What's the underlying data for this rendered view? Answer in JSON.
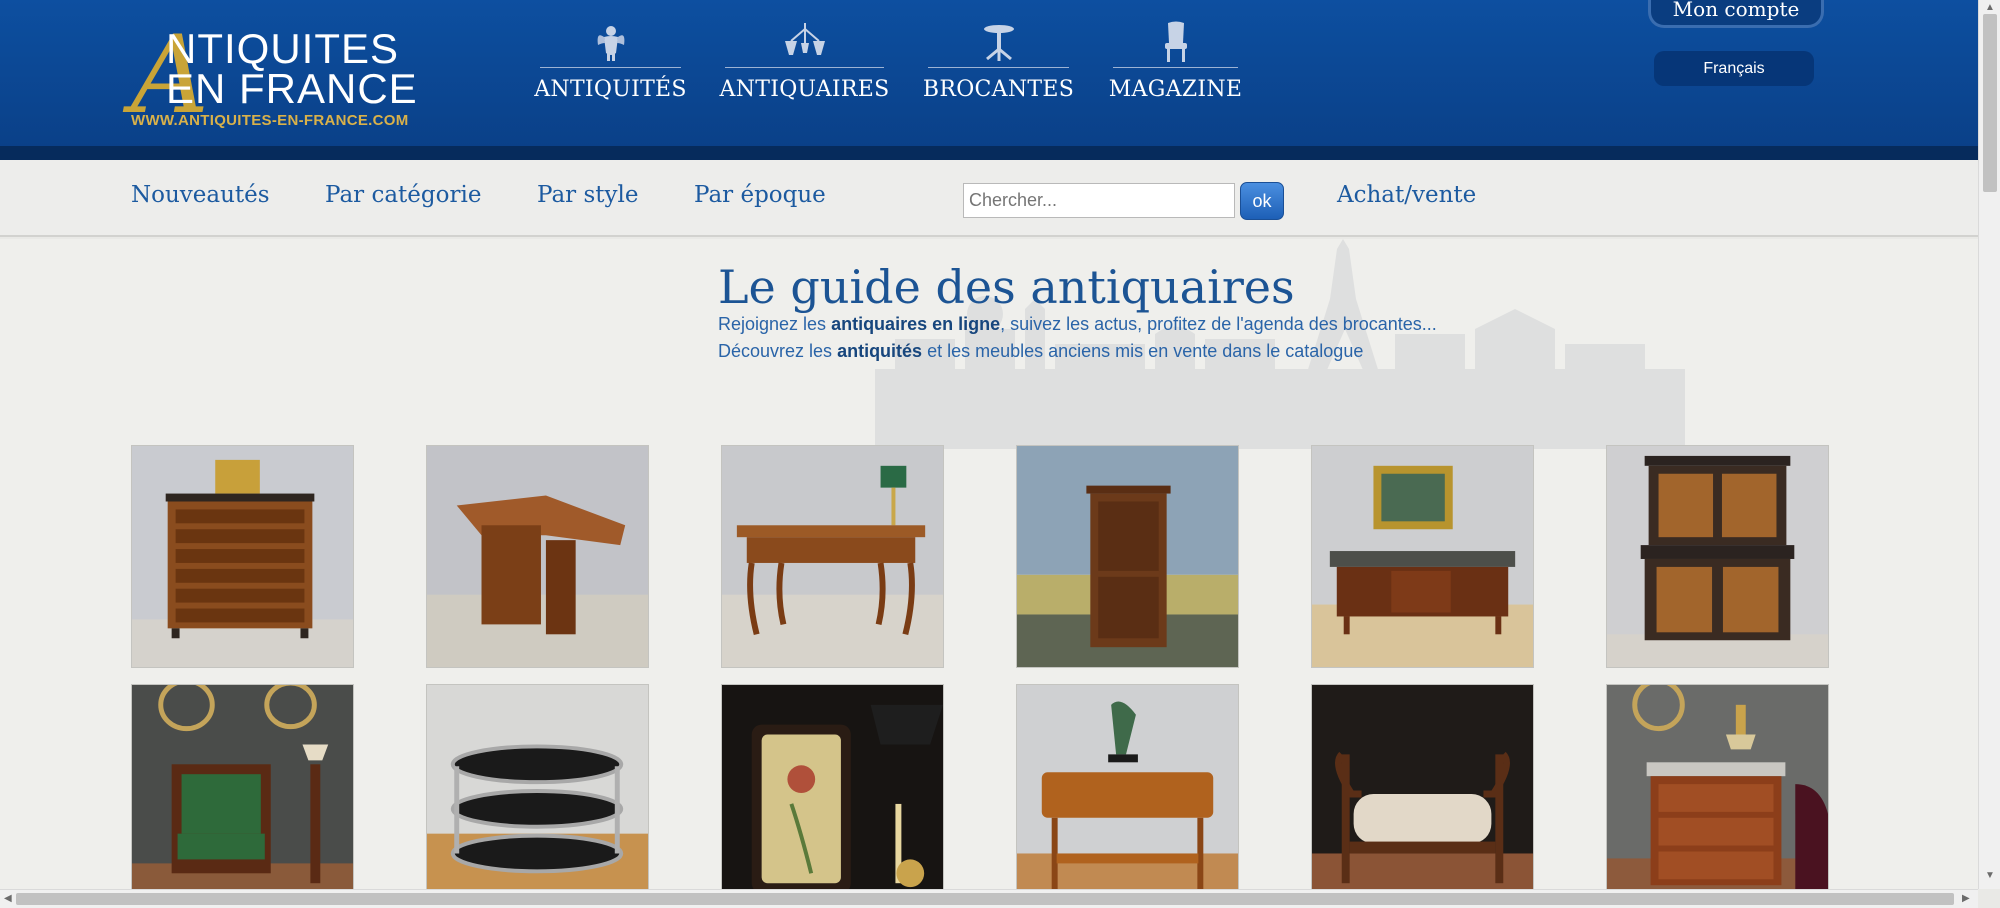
{
  "logo": {
    "letter": "A",
    "line1": "NTIQUITES",
    "line2": "EN FRANCE",
    "url": "WWW.ANTIQUITES-EN-FRANCE.COM"
  },
  "main_nav": [
    {
      "label": "ANTIQUITÉS",
      "icon": "cherub-icon"
    },
    {
      "label": "ANTIQUAIRES",
      "icon": "chandelier-icon"
    },
    {
      "label": "BROCANTES",
      "icon": "pedestal-table-icon"
    },
    {
      "label": "MAGAZINE",
      "icon": "chair-icon"
    }
  ],
  "account": {
    "label": "Mon compte"
  },
  "language": {
    "label": "Français"
  },
  "sub_nav": {
    "nouveautes": "Nouveautés",
    "categorie": "Par catégorie",
    "style": "Par style",
    "epoque": "Par époque",
    "achat_vente": "Achat/vente"
  },
  "search": {
    "placeholder": "Chercher...",
    "button": "ok"
  },
  "intro": {
    "title": "Le guide des antiquaires",
    "line1_a": "Rejoignez les ",
    "line1_b": "antiquaires en ligne",
    "line1_c": ", suivez les actus, profitez de l'agenda des brocantes...",
    "line2_a": "Découvrez les ",
    "line2_b": "antiquités",
    "line2_c": " et les meubles anciens mis en vente dans le catalogue"
  },
  "colors": {
    "header_blue": "#0d4fa0",
    "gold": "#c9a437",
    "link_blue": "#1c5aa0"
  }
}
